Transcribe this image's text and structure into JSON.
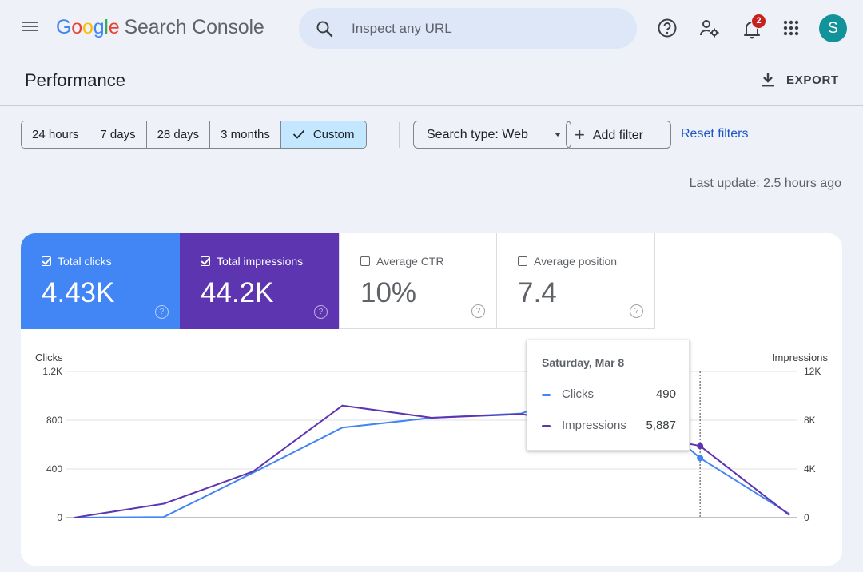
{
  "app": {
    "brand": [
      "G",
      "o",
      "o",
      "g",
      "l",
      "e"
    ],
    "product": "Search Console"
  },
  "colors": {
    "brand_letters": [
      "#4285f4",
      "#ea4335",
      "#fbbc05",
      "#4285f4",
      "#34a853",
      "#ea4335"
    ],
    "clicks": "#4285f4",
    "impressions": "#5e35b1",
    "link": "#1a56c9",
    "badge": "#c5221f",
    "avatar": "#12939a"
  },
  "header": {
    "search_placeholder": "Inspect any URL",
    "notification_count": "2",
    "avatar_letter": "S",
    "icons": [
      "menu-icon",
      "search-icon",
      "help-icon",
      "manage-users-icon",
      "notifications-icon",
      "apps-grid-icon"
    ]
  },
  "page": {
    "title": "Performance",
    "export_label": "EXPORT"
  },
  "filters": {
    "ranges": [
      "24 hours",
      "7 days",
      "28 days",
      "3 months",
      "Custom"
    ],
    "active_range": "Custom",
    "search_type": "Search type: Web",
    "add_filter": "Add filter",
    "reset": "Reset filters",
    "last_update": "Last update: 2.5 hours ago"
  },
  "metrics": [
    {
      "label": "Total clicks",
      "value": "4.43K",
      "checked": true
    },
    {
      "label": "Total impressions",
      "value": "44.2K",
      "checked": true
    },
    {
      "label": "Average CTR",
      "value": "10%",
      "checked": false
    },
    {
      "label": "Average position",
      "value": "7.4",
      "checked": false
    }
  ],
  "tooltip": {
    "date": "Saturday, Mar 8",
    "rows": [
      {
        "label": "Clicks",
        "value": "490"
      },
      {
        "label": "Impressions",
        "value": "5,887"
      }
    ]
  },
  "chart_data": {
    "type": "line",
    "left_axis": {
      "label": "Clicks",
      "ticks": [
        "0",
        "400",
        "800",
        "1.2K"
      ],
      "range": [
        0,
        1200
      ]
    },
    "right_axis": {
      "label": "Impressions",
      "ticks": [
        "0",
        "4K",
        "8K",
        "12K"
      ],
      "range": [
        0,
        12000
      ]
    },
    "grid": true,
    "x": [
      0,
      1,
      2,
      3,
      4,
      5,
      6,
      7,
      8
    ],
    "series": [
      {
        "name": "Clicks",
        "axis": "left",
        "values": [
          0,
          5,
          370,
          740,
          820,
          855,
          1110,
          490,
          30
        ]
      },
      {
        "name": "Impressions",
        "axis": "right",
        "values": [
          0,
          1150,
          3800,
          9200,
          8200,
          8500,
          7300,
          5887,
          200
        ]
      }
    ],
    "highlight_index": 7
  }
}
